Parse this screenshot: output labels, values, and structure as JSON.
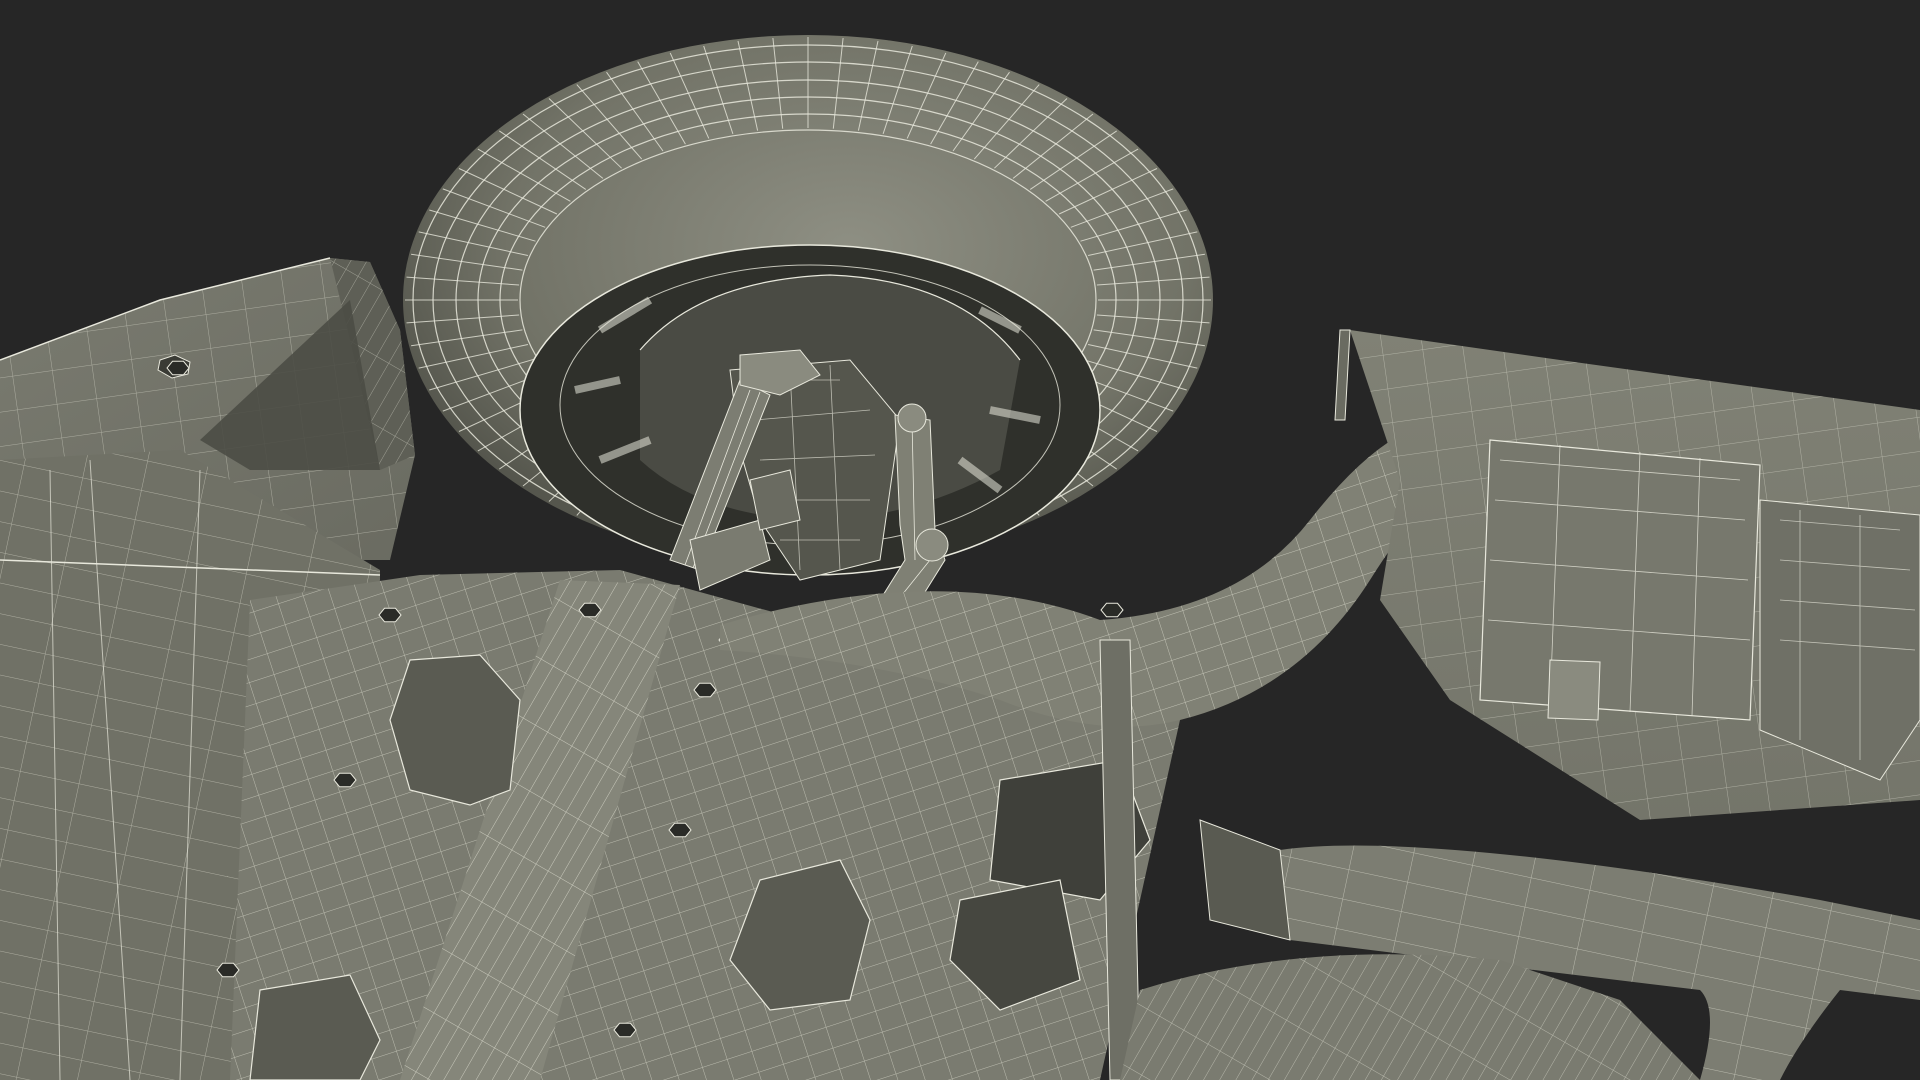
{
  "scene": {
    "subject": "wireframe-render",
    "colors": {
      "background": "#262626",
      "surface": "#7d7e72",
      "surface_light": "#8d8e82",
      "surface_dark": "#5f6056",
      "shadow": "#3a3b35",
      "wire": "#e8e8dc"
    }
  }
}
